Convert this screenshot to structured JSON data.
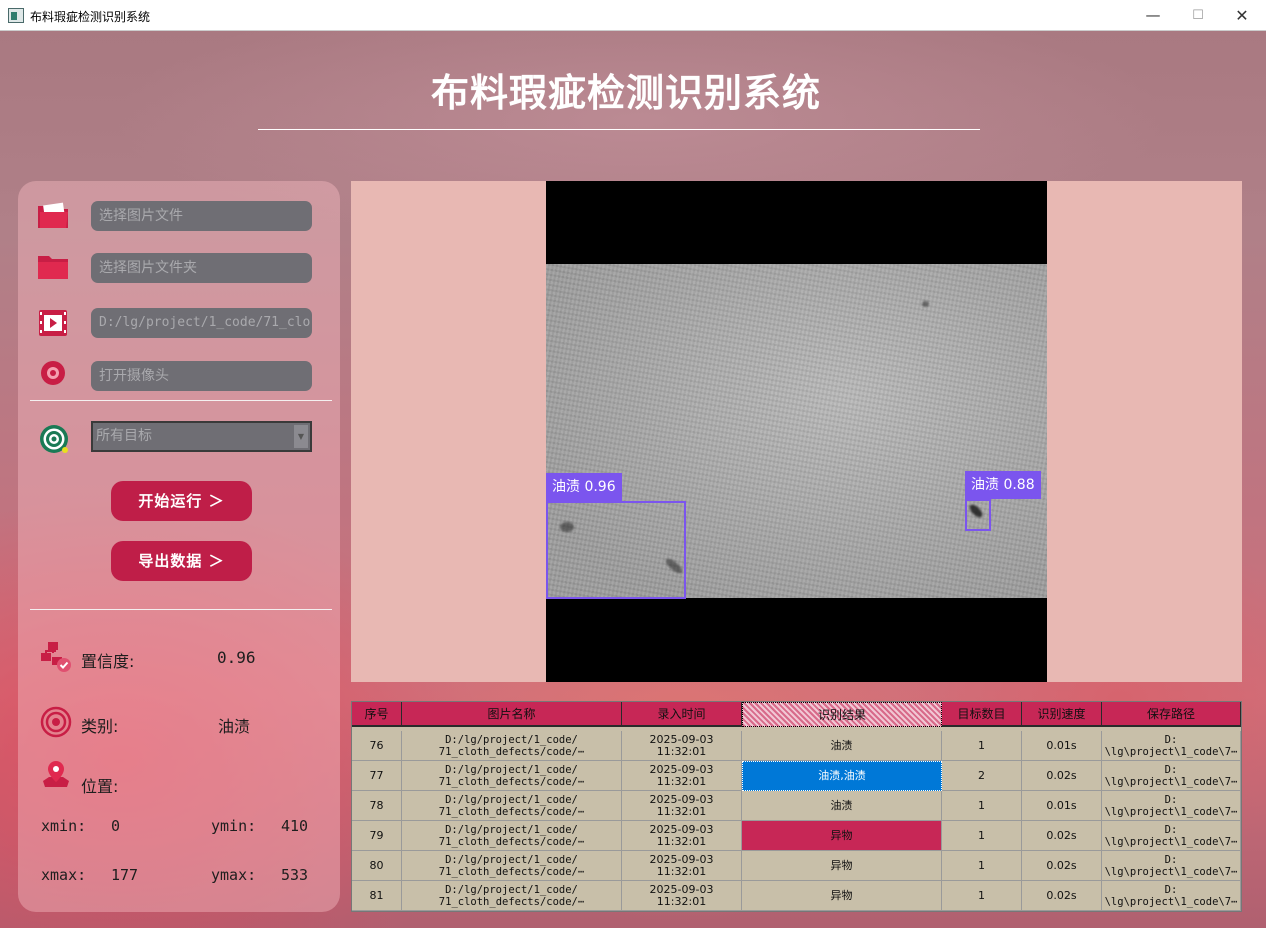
{
  "window": {
    "title": "布料瑕疵检测识别系统",
    "minimize": "—",
    "maximize": "☐",
    "close": "✕"
  },
  "header": {
    "title": "布料瑕疵检测识别系统"
  },
  "sidebar": {
    "image_file_placeholder": "选择图片文件",
    "image_folder_placeholder": "选择图片文件夹",
    "video_path": "D:/lg/project/1_code/71_clo",
    "camera_placeholder": "打开摄像头",
    "target_select": "所有目标",
    "run_button": "开始运行 ＞",
    "export_button": "导出数据 ＞"
  },
  "result": {
    "confidence_label": "置信度:",
    "confidence_value": "0.96",
    "class_label": "类别:",
    "class_value": "油渍",
    "position_label": "位置:",
    "xmin_label": "xmin:",
    "xmin_value": "0",
    "ymin_label": "ymin:",
    "ymin_value": "410",
    "xmax_label": "xmax:",
    "xmax_value": "177",
    "ymax_label": "ymax:",
    "ymax_value": "533"
  },
  "detections": [
    {
      "label": "油渍 0.96"
    },
    {
      "label": "油渍 0.88"
    }
  ],
  "table": {
    "columns": [
      "序号",
      "图片名称",
      "录入时间",
      "识别结果",
      "目标数目",
      "识别速度",
      "保存路径"
    ],
    "rows": [
      {
        "idx": "76",
        "name": "D:/lg/project/1_code/\n71_cloth_defects/code/⋯",
        "time": "2025-09-03\n11:32:01",
        "result": "油渍",
        "count": "1",
        "speed": "0.01s",
        "path": "D:\n\\lg\\project\\1_code\\7⋯"
      },
      {
        "idx": "77",
        "name": "D:/lg/project/1_code/\n71_cloth_defects/code/⋯",
        "time": "2025-09-03\n11:32:01",
        "result": "油渍,油渍",
        "count": "2",
        "speed": "0.02s",
        "path": "D:\n\\lg\\project\\1_code\\7⋯"
      },
      {
        "idx": "78",
        "name": "D:/lg/project/1_code/\n71_cloth_defects/code/⋯",
        "time": "2025-09-03\n11:32:01",
        "result": "油渍",
        "count": "1",
        "speed": "0.01s",
        "path": "D:\n\\lg\\project\\1_code\\7⋯"
      },
      {
        "idx": "79",
        "name": "D:/lg/project/1_code/\n71_cloth_defects/code/⋯",
        "time": "2025-09-03\n11:32:01",
        "result": "异物",
        "count": "1",
        "speed": "0.02s",
        "path": "D:\n\\lg\\project\\1_code\\7⋯"
      },
      {
        "idx": "80",
        "name": "D:/lg/project/1_code/\n71_cloth_defects/code/⋯",
        "time": "2025-09-03\n11:32:01",
        "result": "异物",
        "count": "1",
        "speed": "0.02s",
        "path": "D:\n\\lg\\project\\1_code\\7⋯"
      },
      {
        "idx": "81",
        "name": "D:/lg/project/1_code/\n71_cloth_defects/code/⋯",
        "time": "2025-09-03\n11:32:01",
        "result": "异物",
        "count": "1",
        "speed": "0.02s",
        "path": "D:\n\\lg\\project\\1_code\\7⋯"
      }
    ]
  },
  "colors": {
    "accent": "#bf1e48",
    "table_header": "#c72756",
    "bbox": "#7b55ee",
    "selection": "#0078d7"
  }
}
